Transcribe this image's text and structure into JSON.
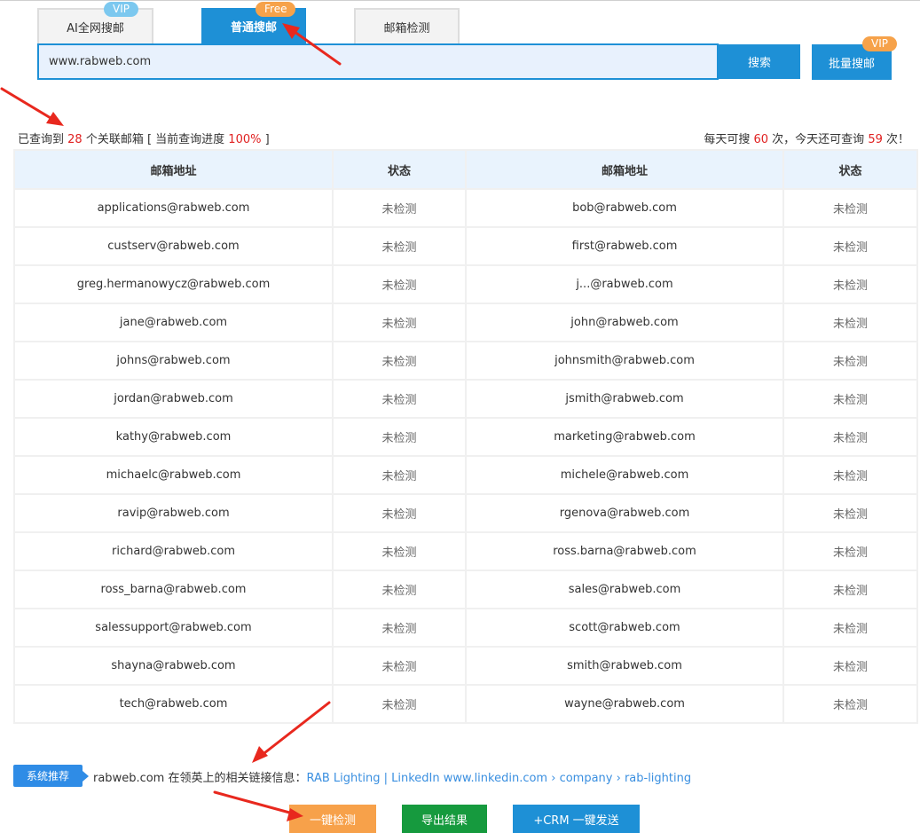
{
  "tabs": [
    {
      "label": "AI全网搜邮",
      "tag": "VIP"
    },
    {
      "label": "普通搜邮",
      "tag": "Free"
    },
    {
      "label": "邮箱检测"
    }
  ],
  "search": {
    "value": "www.rabweb.com",
    "button_label": "搜索",
    "bulk_label": "批量搜邮",
    "bulk_tag": "VIP"
  },
  "summary": {
    "prefix": "已查询到 ",
    "count": "28",
    "mid": " 个关联邮箱 [ 当前查询进度 ",
    "progress": "100%",
    "suffix": " ]",
    "daily_prefix": "每天可搜 ",
    "daily_total": "60",
    "daily_mid": " 次，今天还可查询 ",
    "daily_left": "59",
    "daily_suffix": " 次！"
  },
  "table": {
    "headers": [
      "邮箱地址",
      "状态",
      "邮箱地址",
      "状态"
    ],
    "rows": [
      [
        "applications@rabweb.com",
        "未检测",
        "bob@rabweb.com",
        "未检测"
      ],
      [
        "custserv@rabweb.com",
        "未检测",
        "first@rabweb.com",
        "未检测"
      ],
      [
        "greg.hermanowycz@rabweb.com",
        "未检测",
        "j...@rabweb.com",
        "未检测"
      ],
      [
        "jane@rabweb.com",
        "未检测",
        "john@rabweb.com",
        "未检测"
      ],
      [
        "johns@rabweb.com",
        "未检测",
        "johnsmith@rabweb.com",
        "未检测"
      ],
      [
        "jordan@rabweb.com",
        "未检测",
        "jsmith@rabweb.com",
        "未检测"
      ],
      [
        "kathy@rabweb.com",
        "未检测",
        "marketing@rabweb.com",
        "未检测"
      ],
      [
        "michaelc@rabweb.com",
        "未检测",
        "michele@rabweb.com",
        "未检测"
      ],
      [
        "ravip@rabweb.com",
        "未检测",
        "rgenova@rabweb.com",
        "未检测"
      ],
      [
        "richard@rabweb.com",
        "未检测",
        "ross.barna@rabweb.com",
        "未检测"
      ],
      [
        "ross_barna@rabweb.com",
        "未检测",
        "sales@rabweb.com",
        "未检测"
      ],
      [
        "salessupport@rabweb.com",
        "未检测",
        "scott@rabweb.com",
        "未检测"
      ],
      [
        "shayna@rabweb.com",
        "未检测",
        "smith@rabweb.com",
        "未检测"
      ],
      [
        "tech@rabweb.com",
        "未检测",
        "wayne@rabweb.com",
        "未检测"
      ]
    ]
  },
  "recommend": {
    "badge": "系统推荐",
    "text": "rabweb.com 在领英上的相关链接信息：",
    "link": "RAB Lighting | LinkedIn www.linkedin.com › company › rab-lighting"
  },
  "actions": {
    "check": "一键检测",
    "export": "导出结果",
    "crm": "+CRM 一键发送"
  },
  "colors": {
    "accent": "#1e90d6",
    "highlight": "#e02020",
    "check_button": "#f7a14a",
    "export_button": "#169a3e",
    "annotation_arrow": "#e8281e"
  }
}
